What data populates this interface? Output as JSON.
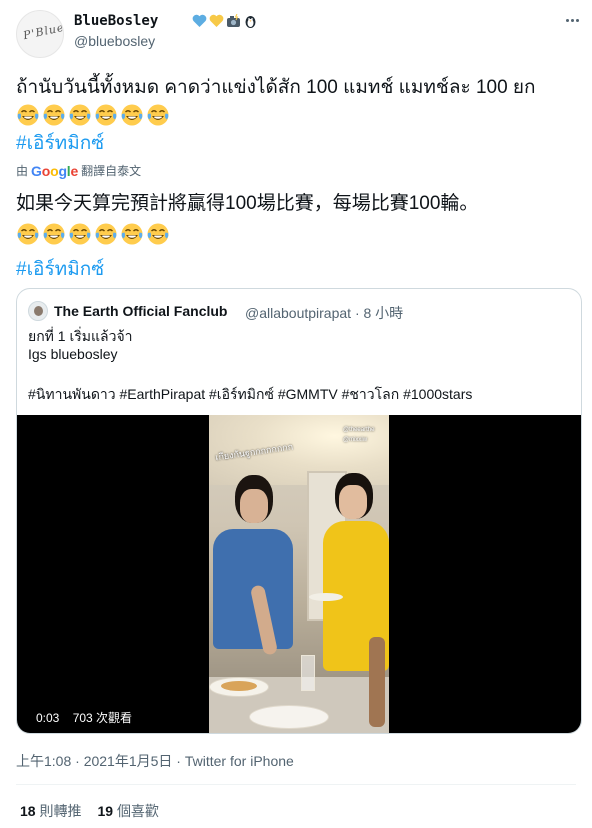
{
  "author": {
    "display_name": "BlueBosley",
    "handle": "@bluebosley",
    "avatar_text": "P'Blue",
    "name_emojis": [
      "blue-heart",
      "yellow-heart",
      "camera-flash",
      "penguin"
    ]
  },
  "tweet": {
    "text_th": "ถ้านับวันนี้ทั้งหมด คาดว่าแข่งได้สัก 100 แมทช์ แมทช์ละ 100 ยก",
    "hashtag": "#เอิร์ทมิกซ์",
    "translate_by": "由",
    "translate_brand": "Google",
    "translate_action": "翻譯自泰文",
    "text_zh": "如果今天算完預計將贏得100場比賽，每場比賽100輪。",
    "emoji_count_th": 6,
    "emoji_count_zh": 6,
    "emoji_name": "face-with-tears-of-joy"
  },
  "quote": {
    "display_name": "The Earth Official Fanclub",
    "handle_time": "@allaboutpirapat · 8 小時",
    "line1": "ยกที่ 1 เริ่มแล้วจ้า",
    "line2": "Igs bluebosley",
    "line3": "#นิทานพันดาว #EarthPirapat #เอิร์ทมิกซ์  #GMMTV #ชาวโลก #1000stars",
    "video": {
      "overlay_text": "เกียงกันฐูกกกกกกกก",
      "tag1": "@theearthe",
      "tag2": "@mixxiw",
      "duration": "0:03",
      "views": "703 次觀看"
    }
  },
  "meta": {
    "time": "上午1:08 · 2021年1月5日",
    "separator": " · ",
    "source": "Twitter for iPhone"
  },
  "stats": {
    "retweets_count": "18",
    "retweets_label": "則轉推",
    "likes_count": "19",
    "likes_label": "個喜歡"
  },
  "colors": {
    "link": "#1d9bf0",
    "secondary_text": "#536471",
    "border": "#cfd9de"
  }
}
